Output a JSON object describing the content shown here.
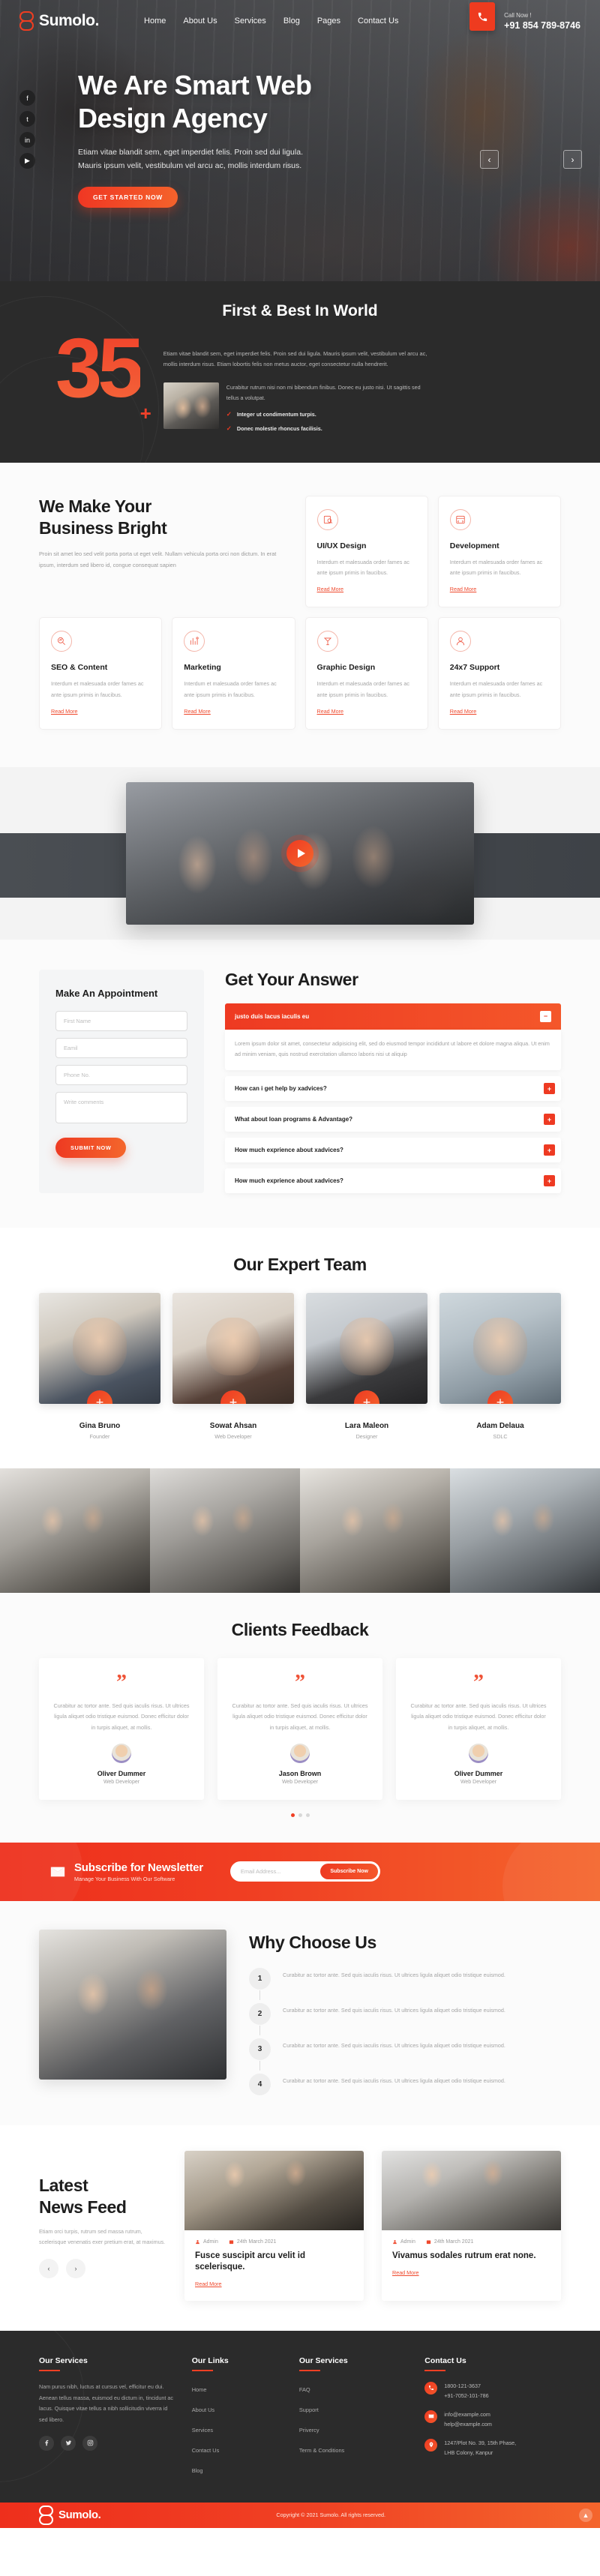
{
  "brand": {
    "name": "Sumolo."
  },
  "nav": {
    "items": [
      "Home",
      "About Us",
      "Services",
      "Blog",
      "Pages",
      "Contact Us"
    ]
  },
  "call": {
    "label": "Call Now !",
    "number": "+91 854 789-8746"
  },
  "hero": {
    "title_line1": "We Are Smart Web",
    "title_line2": "Design Agency",
    "paragraph": "Etiam vitae blandit sem, eget imperdiet felis. Proin sed dui ligula. Mauris ipsum velit, vestibulum vel arcu ac, mollis interdum risus.",
    "cta": "GET STARTED NOW",
    "social": [
      "f",
      "t",
      "in",
      "▶"
    ],
    "prev": "‹",
    "next": "›"
  },
  "stats": {
    "title": "First & Best In World",
    "number": "35",
    "plus": "+",
    "lead": "Etiam vitae blandit sem, eget imperdiet felis. Proin sed dui ligula. Mauris ipsum velit, vestibulum vel arcu ac, mollis interdum risus. Etiam lobortis felis non metus auctor, eget consectetur nulla hendrerit.",
    "sub": "Curabitur rutrum nisi non mi bibendum finibus. Donec eu justo nisi. Ut sagittis sed tellus a volutpat.",
    "checks": [
      "Integer ut condimentum turpis.",
      "Donec molestie rhoncus facilisis."
    ]
  },
  "services": {
    "heading_line1": "We Make Your",
    "heading_line2": "Business Bright",
    "paragraph": "Proin sit amet leo sed velit porta porta ut eget velit. Nullam vehicula porta orci non dictum. In erat ipsum, interdum sed libero id, congue consequat sapien",
    "read_more": "Read More",
    "body": "Interdum et malesuada order fames ac ante ipsum primis in faucibus.",
    "cards": [
      {
        "title": "UI/UX Design",
        "icon": "design-icon"
      },
      {
        "title": "Development",
        "icon": "code-icon"
      },
      {
        "title": "SEO & Content",
        "icon": "seo-icon"
      },
      {
        "title": "Marketing",
        "icon": "marketing-icon"
      },
      {
        "title": "Graphic Design",
        "icon": "graphic-icon"
      },
      {
        "title": "24x7 Support",
        "icon": "support-icon"
      }
    ]
  },
  "appointment": {
    "title": "Make An Appointment",
    "fields": {
      "first_name": "First Name",
      "email": "Eamil",
      "phone": "Phone No.",
      "comments": "Write comments"
    },
    "submit": "SUBMIT NOW"
  },
  "faq": {
    "title": "Get Your Answer",
    "open": {
      "question": "justo duis lacus iaculis eu",
      "answer": "Lorem ipsum dolor sit amet, consectetur adipisicing elit, sed do eiusmod tempor incididunt ut labore et dolore magna aliqua. Ut enim ad minim veniam, quis nostrud exercitation ullamco laboris nisi ut aliquip",
      "toggle": "−"
    },
    "items": [
      {
        "question": "How can i get help by xadvices?",
        "toggle": "+"
      },
      {
        "question": "What about loan programs & Advantage?",
        "toggle": "+"
      },
      {
        "question": "How much exprience about xadvices?",
        "toggle": "+"
      },
      {
        "question": "How much exprience about xadvices?",
        "toggle": "+"
      }
    ]
  },
  "team": {
    "title": "Our Expert Team",
    "plus": "+",
    "members": [
      {
        "name": "Gina Bruno",
        "role": "Founder"
      },
      {
        "name": "Sowat Ahsan",
        "role": "Web Developer"
      },
      {
        "name": "Lara Maleon",
        "role": "Designer"
      },
      {
        "name": "Adam Delaua",
        "role": "SDLC"
      }
    ]
  },
  "feedback": {
    "title": "Clients Feedback",
    "quote_glyph": "”",
    "cards": [
      {
        "text": "Curabitur ac tortor ante. Sed quis iaculis risus. Ut ultrices ligula aliquet odio tristique euismod. Donec efficitur dolor in turpis aliquet, at mollis.",
        "name": "Oliver Dummer",
        "role": "Web Developer"
      },
      {
        "text": "Curabitur ac tortor ante. Sed quis iaculis risus. Ut ultrices ligula aliquet odio tristique euismod. Donec efficitur dolor in turpis aliquet, at mollis.",
        "name": "Jason Brown",
        "role": "Web Developer"
      },
      {
        "text": "Curabitur ac tortor ante. Sed quis iaculis risus. Ut ultrices ligula aliquet odio tristique euismod. Donec efficitur dolor in turpis aliquet, at mollis.",
        "name": "Oliver Dummer",
        "role": "Web Developer"
      }
    ]
  },
  "newsletter": {
    "title": "Subscribe for Newsletter",
    "subtitle": "Manage Your Business With Our Software",
    "placeholder": "Email Address...",
    "button": "Subscribe Now"
  },
  "why": {
    "title": "Why Choose Us",
    "steps": [
      {
        "num": "1",
        "text": "Curabitur ac tortor ante. Sed quis iaculis risus. Ut ultrices ligula aliquet odio tristique euismod."
      },
      {
        "num": "2",
        "text": "Curabitur ac tortor ante. Sed quis iaculis risus. Ut ultrices ligula aliquet odio tristique euismod."
      },
      {
        "num": "3",
        "text": "Curabitur ac tortor ante. Sed quis iaculis risus. Ut ultrices ligula aliquet odio tristique euismod."
      },
      {
        "num": "4",
        "text": "Curabitur ac tortor ante. Sed quis iaculis risus. Ut ultrices ligula aliquet odio tristique euismod."
      }
    ]
  },
  "feed": {
    "heading_line1": "Latest",
    "heading_line2": "News Feed",
    "paragraph": "Etiam orci turpis, rutrum sed massa rutrum, scelerisque venenatis exer pretium erat, at maximus.",
    "prev": "‹",
    "next": "›",
    "read_more": "Read More",
    "posts": [
      {
        "author": "Admin",
        "date": "24th March 2021",
        "title": "Fusce suscipit arcu velit id scelerisque."
      },
      {
        "author": "Admin",
        "date": "24th March 2021",
        "title": "Vivamus sodales rutrum erat none."
      }
    ]
  },
  "footer": {
    "col1": {
      "title": "Our Services",
      "text": "Nam purus nibh, luctus at cursus vel, efficitur eu dui. Aenean tellus massa, euismod eu dictum in, tincidunt ac lacus. Quisque vitae tellus a nibh sollicitudin viverra id sed libero.",
      "social": [
        "facebook-icon",
        "twitter-icon",
        "instagram-icon"
      ]
    },
    "col2": {
      "title": "Our Links",
      "links": [
        "Home",
        "About Us",
        "Services",
        "Contact Us",
        "Blog"
      ]
    },
    "col3": {
      "title": "Our Services",
      "links": [
        "FAQ",
        "Support",
        "Privercy",
        "Term & Conditions"
      ]
    },
    "col4": {
      "title": "Contact Us",
      "rows": [
        {
          "icon": "phone-icon",
          "lines": [
            "1800-121-3637",
            "+91-7052-101-786"
          ]
        },
        {
          "icon": "mail-icon",
          "lines": [
            "info@example.com",
            "help@example.com"
          ]
        },
        {
          "icon": "location-icon",
          "lines": [
            "1247/Plot No. 39, 15th Phase,",
            "LHB Colony, Kanpur"
          ]
        }
      ]
    },
    "copyright": "Copyright © 2021 Sumolo. All rights reserved.",
    "to_top": "▲"
  }
}
